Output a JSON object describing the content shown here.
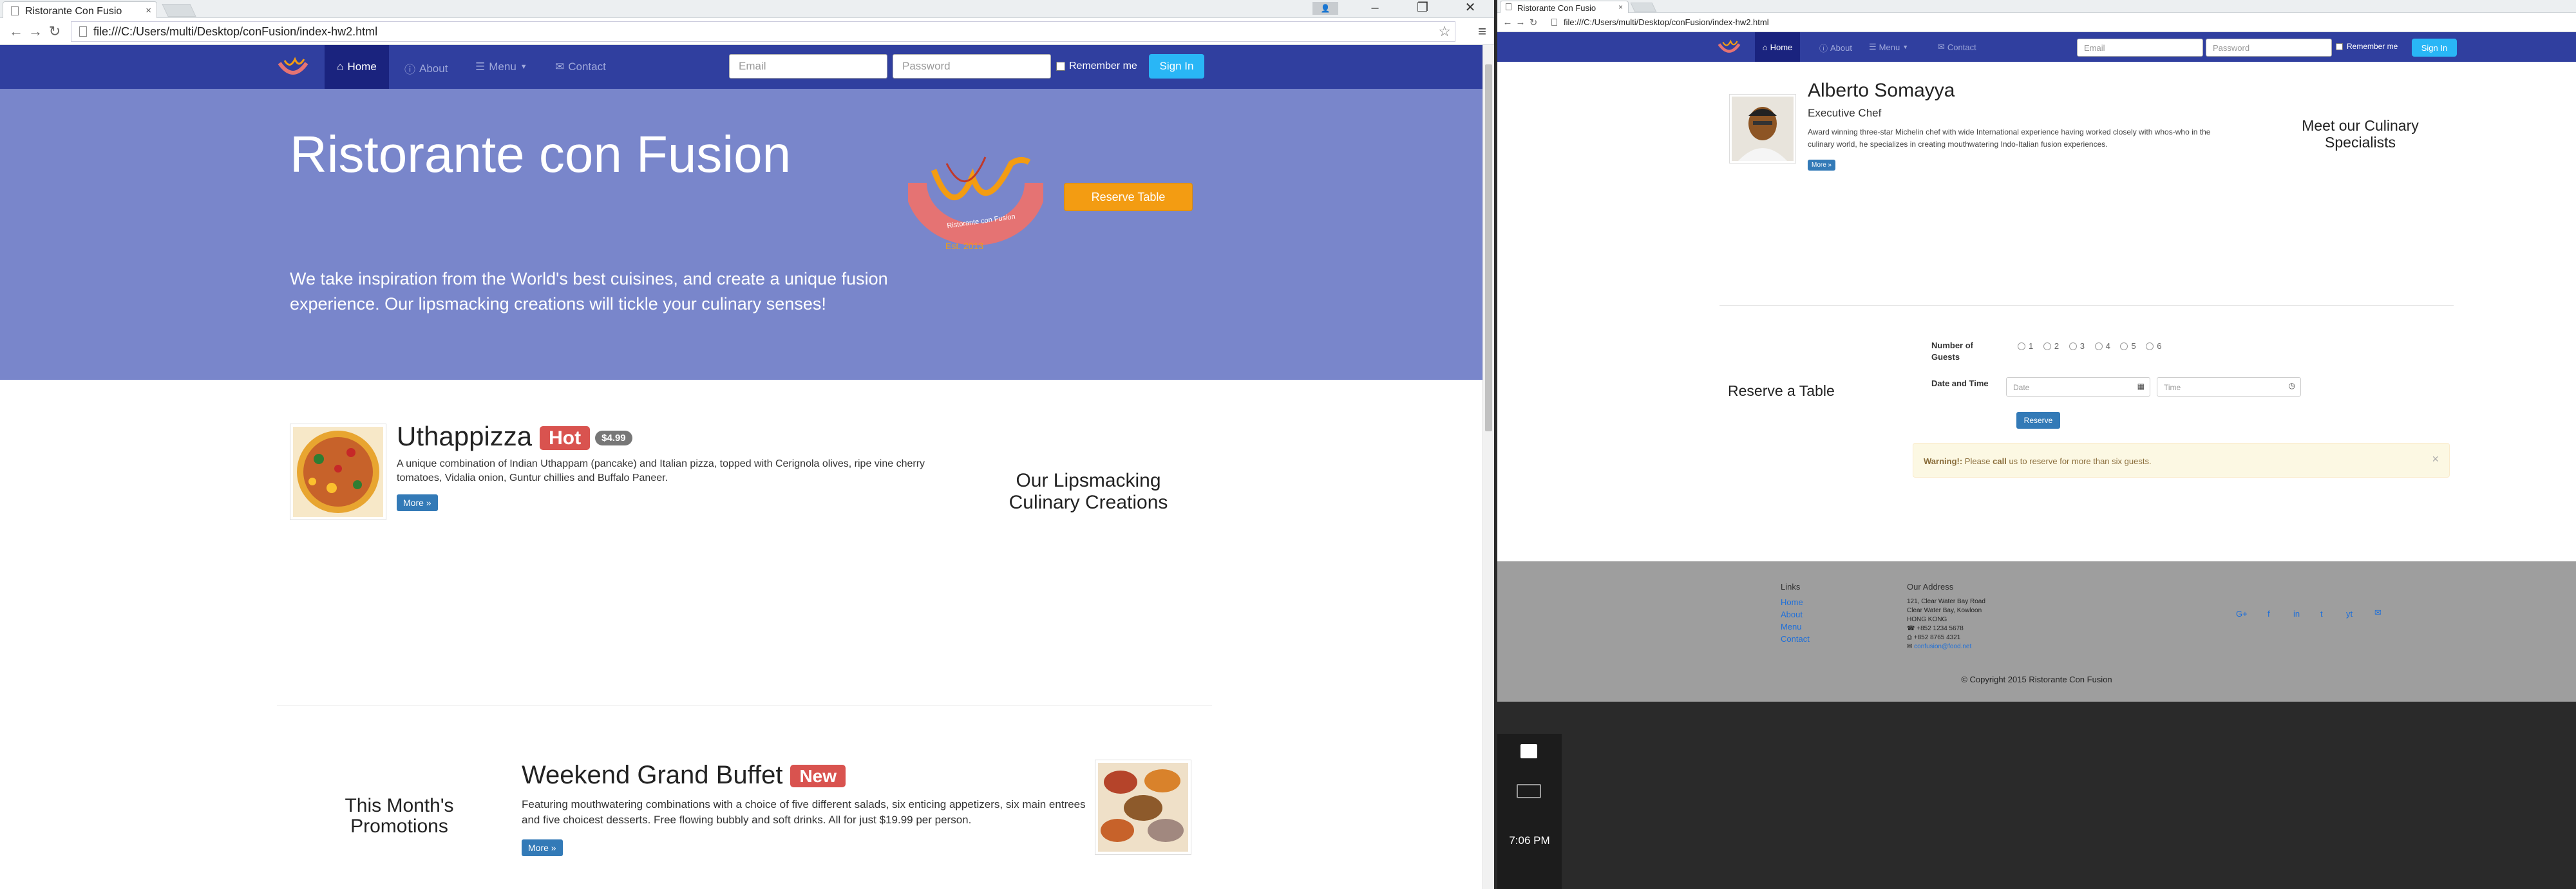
{
  "left_window": {
    "tab_title": "Ristorante Con Fusio",
    "url": "file:///C:/Users/multi/Desktop/conFusion/index-hw2.html",
    "nav": {
      "home": "Home",
      "about": "About",
      "menu": "Menu",
      "contact": "Contact",
      "email_placeholder": "Email",
      "password_placeholder": "Password",
      "remember": "Remember me",
      "signin": "Sign In"
    },
    "jumbotron": {
      "title": "Ristorante con Fusion",
      "tagline": "We take inspiration from the World's best cuisines, and create a unique fusion experience. Our lipsmacking creations will tickle your culinary senses!",
      "reserve": "Reserve Table",
      "logo_text": "Ristorante con Fusion",
      "logo_est": "Est. 2013"
    },
    "dish": {
      "name": "Uthappizza",
      "badge": "Hot",
      "price": "$4.99",
      "description": "A unique combination of Indian Uthappam (pancake) and Italian pizza, topped with Cerignola olives, ripe vine cherry tomatoes, Vidalia onion, Guntur chillies and Buffalo Paneer.",
      "more": "More »",
      "side": "Our Lipsmacking Culinary Creations"
    },
    "promo": {
      "side": "This Month's Promotions",
      "name": "Weekend Grand Buffet",
      "badge": "New",
      "description": "Featuring mouthwatering combinations with a choice of five different salads, six enticing appetizers, six main entrees and five choicest desserts. Free flowing bubbly and soft drinks. All for just $19.99 per person.",
      "more": "More »"
    }
  },
  "right_window": {
    "tab_title": "Ristorante Con Fusio",
    "url": "file:///C:/Users/multi/Desktop/conFusion/index-hw2.html",
    "nav": {
      "home": "Home",
      "about": "About",
      "menu": "Menu",
      "contact": "Contact",
      "email_placeholder": "Email",
      "password_placeholder": "Password",
      "remember": "Remember me",
      "signin": "Sign In"
    },
    "leader": {
      "name": "Alberto Somayya",
      "title": "Executive Chef",
      "description": "Award winning three-star Michelin chef with wide International experience having worked closely with whos-who in the culinary world, he specializes in creating mouthwatering Indo-Italian fusion experiences.",
      "more": "More »",
      "side": "Meet our Culinary Specialists"
    },
    "reserve": {
      "heading": "Reserve a Table",
      "guests_label": "Number of Guests",
      "guests": [
        "1",
        "2",
        "3",
        "4",
        "5",
        "6"
      ],
      "datetime_label": "Date and Time",
      "date_placeholder": "Date",
      "time_placeholder": "Time",
      "button": "Reserve",
      "warning_bold": "Warning!:",
      "warning_text": " Please ",
      "warning_call": "call",
      "warning_rest": " us to reserve for more than six guests.",
      "close": "×"
    },
    "footer": {
      "links_heading": "Links",
      "links": [
        "Home",
        "About",
        "Menu",
        "Contact"
      ],
      "address_heading": "Our Address",
      "address": [
        "121, Clear Water Bay Road",
        "Clear Water Bay, Kowloon",
        "HONG KONG"
      ],
      "phone": "+852 1234 5678",
      "fax": "+852 8765 4321",
      "email": "confusion@food.net",
      "social": [
        "G+",
        "f",
        "in",
        "t",
        "yt",
        "✉"
      ],
      "copyright": "© Copyright 2015 Ristorante Con Fusion"
    }
  },
  "taskbar": {
    "time": "7:06 PM"
  },
  "colors": {
    "navbar": "#303f9f",
    "jumbotron": "#7986cb",
    "accent": "#f39c12",
    "footer": "#9e9e9e",
    "signin": "#29b6f6"
  }
}
